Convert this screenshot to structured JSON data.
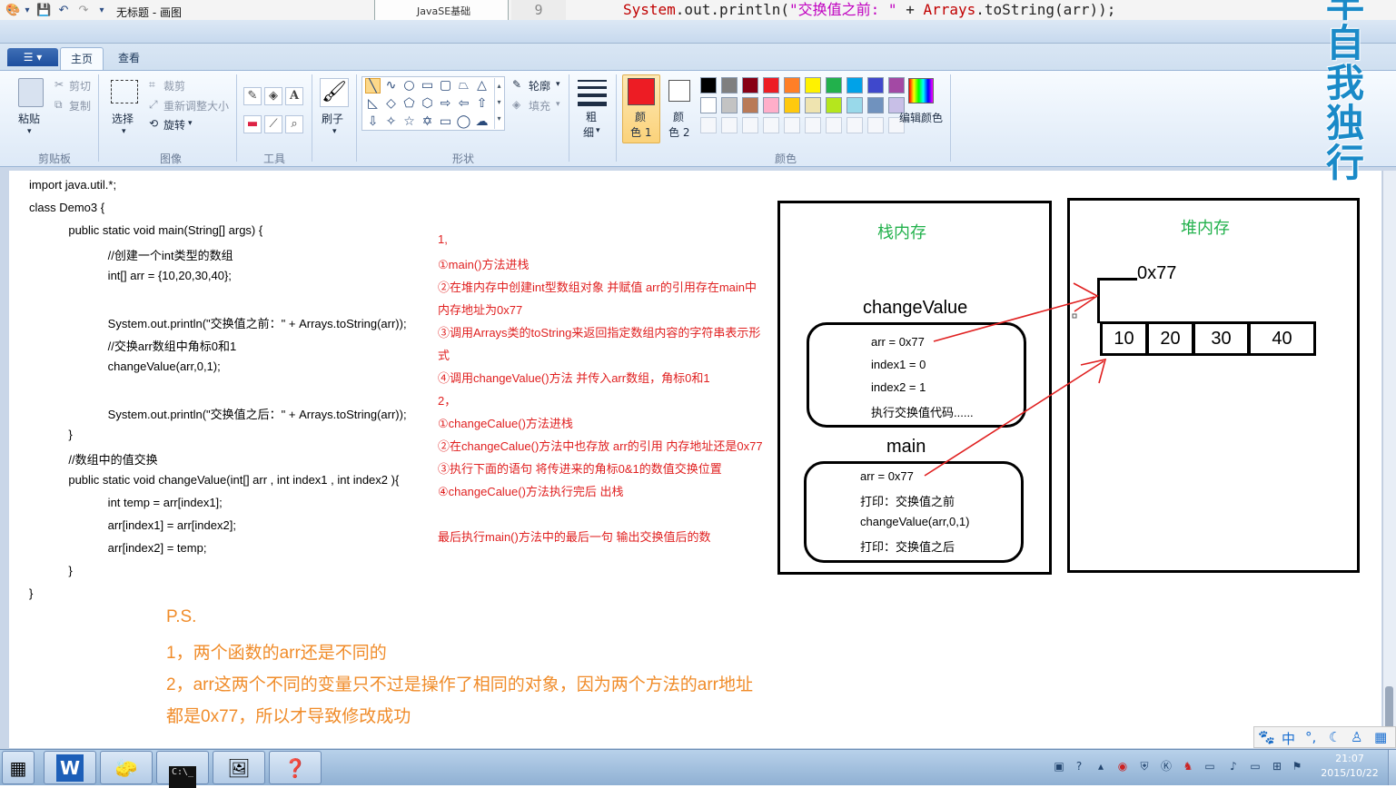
{
  "background_editor": {
    "folder_label": "JavaSE基础",
    "line_number": "9",
    "code_parts": [
      "System",
      ".out.println(",
      "\"交换值之前: \"",
      " + ",
      "Arrays",
      ".toString(arr));"
    ]
  },
  "window": {
    "title": "无标题 - 画图"
  },
  "tabs": [
    {
      "label": "主页"
    },
    {
      "label": "查看"
    }
  ],
  "ribbon": {
    "clipboard": {
      "paste": "粘贴",
      "cut": "剪切",
      "copy": "复制",
      "group": "剪贴板"
    },
    "image": {
      "select": "选择",
      "crop": "裁剪",
      "resize": "重新调整大小",
      "rotate": "旋转",
      "group": "图像"
    },
    "tools": {
      "group": "工具"
    },
    "brushes": {
      "label": "刷子"
    },
    "shapes": {
      "outline": "轮廓",
      "fill": "填充",
      "group": "形状"
    },
    "size": {
      "label_top": "粗",
      "label_bottom": "细"
    },
    "color1": {
      "label_top": "颜",
      "label_bottom": "色 1"
    },
    "color2": {
      "label_top": "颜",
      "label_bottom": "色 2"
    },
    "colors": {
      "edit": "编辑颜色",
      "group": "颜色",
      "row1": [
        "#000000",
        "#7f7f7f",
        "#880015",
        "#ed1c24",
        "#ff7f27",
        "#fff200",
        "#22b14c",
        "#00a2e8",
        "#3f48cc",
        "#a349a4"
      ],
      "row2": [
        "#ffffff",
        "#c3c3c3",
        "#b97a57",
        "#ffaec9",
        "#ffc90e",
        "#efe4b0",
        "#b5e61d",
        "#99d9ea",
        "#7092be",
        "#c8bfe7"
      ],
      "primary": "#ed1c24",
      "secondary": "#ffffff"
    }
  },
  "canvas": {
    "code_lines": [
      "import java.util.*;",
      "class Demo3 {",
      "            public static void main(String[] args) {",
      "                        //创建一个int类型的数组",
      "                        int[] arr = {10,20,30,40};",
      "",
      "                        System.out.println(\"交换值之前：\" + Arrays.toString(arr));",
      "                        //交换arr数组中角标0和1",
      "                        changeValue(arr,0,1);",
      "",
      "                        System.out.println(\"交换值之后：\" + Arrays.toString(arr));",
      "            }",
      "            //数组中的值交换",
      "            public static void changeValue(int[] arr , int index1 , int index2 ){",
      "                        int temp = arr[index1];",
      "                        arr[index1] = arr[index2];",
      "                        arr[index2] = temp;",
      "            }",
      "}"
    ],
    "notes": [
      "1,",
      "①main()方法进栈",
      "②在堆内存中创建int型数组对象 并赋值 arr的引用存在main中",
      "内存地址为0x77",
      "③调用Arrays类的toString来返回指定数组内容的字符串表示形",
      "式",
      "④调用changeValue()方法 并传入arr数组，角标0和1",
      "2，",
      "①changeCalue()方法进栈",
      "②在changeCalue()方法中也存放 arr的引用 内存地址还是0x77",
      "③执行下面的语句 将传进来的角标0&1的数值交换位置",
      "④changeCalue()方法执行完后 出栈",
      "",
      "最后执行main()方法中的最后一句 输出交换值后的数"
    ],
    "ps_lines": [
      "P.S.",
      "1，两个函数的arr还是不同的",
      "2，arr这两个不同的变量只不过是操作了相同的对象，因为两个方法的arr地址",
      "都是0x77，所以才导致修改成功"
    ],
    "stack": {
      "title": "栈内存",
      "change_frame_label": "changeValue",
      "change_frame_lines": [
        "arr = 0x77",
        "index1 = 0",
        "index2 = 1",
        "执行交换值代码......"
      ],
      "main_frame_label": "main",
      "main_frame_lines": [
        "arr = 0x77",
        "打印：交换值之前",
        "changeValue(arr,0,1)",
        "打印：交换值之后"
      ]
    },
    "heap": {
      "title": "堆内存",
      "address": "0x77",
      "cells": [
        "10",
        "20",
        "30",
        "40"
      ]
    }
  },
  "watermark": {
    "chars": [
      "早",
      "自",
      "我",
      "独",
      "行"
    ]
  },
  "ime": {
    "mode": "中"
  },
  "taskbar": {
    "time": "21:07",
    "date": "2015/10/22"
  }
}
